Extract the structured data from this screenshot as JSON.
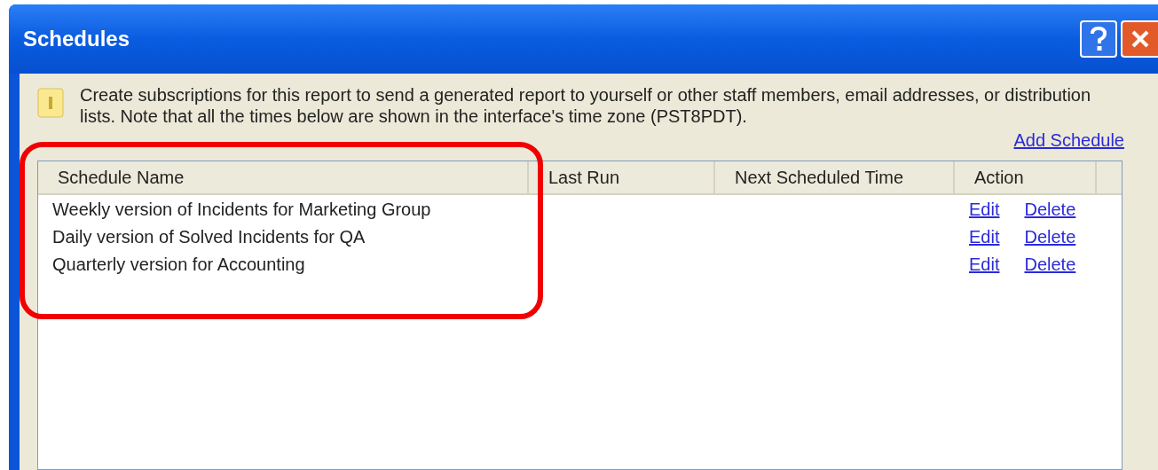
{
  "window": {
    "title": "Schedules"
  },
  "info": {
    "message": "Create subscriptions for this report to send a generated report to yourself or other staff members, email addresses, or distribution lists. Note that all the times below are shown in the interface's time zone (PST8PDT)."
  },
  "add_link": "Add Schedule",
  "table": {
    "columns": [
      "Schedule Name",
      "Last Run",
      "Next Scheduled Time",
      "Action"
    ],
    "rows": [
      {
        "name": "Weekly version of Incidents for Marketing Group",
        "actions": [
          "Edit",
          "Delete"
        ]
      },
      {
        "name": "Daily version of Solved Incidents for QA",
        "actions": [
          "Edit",
          "Delete"
        ]
      },
      {
        "name": "Quarterly version for Accounting",
        "actions": [
          "Edit",
          "Delete"
        ]
      }
    ]
  }
}
